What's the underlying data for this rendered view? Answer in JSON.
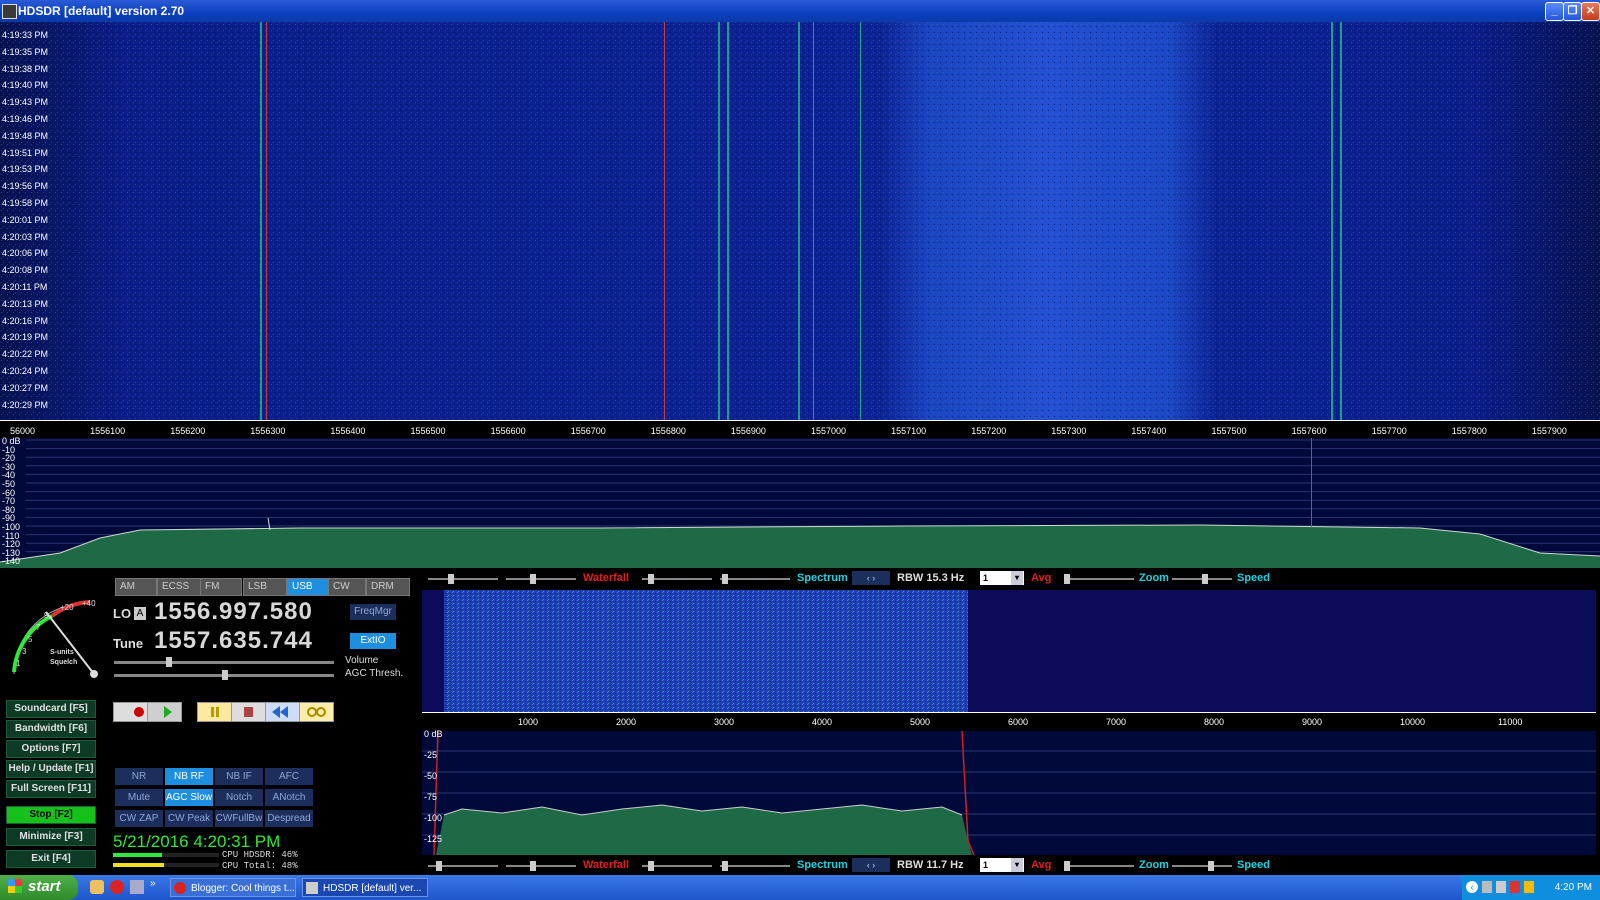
{
  "window": {
    "title": "HDSDR [default]  version 2.70"
  },
  "waterfall": {
    "times": [
      "4:19:33 PM",
      "4:19:35 PM",
      "4:19:38 PM",
      "4:19:40 PM",
      "4:19:43 PM",
      "4:19:46 PM",
      "4:19:48 PM",
      "4:19:51 PM",
      "4:19:53 PM",
      "4:19:56 PM",
      "4:19:58 PM",
      "4:20:01 PM",
      "4:20:03 PM",
      "4:20:06 PM",
      "4:20:08 PM",
      "4:20:11 PM",
      "4:20:13 PM",
      "4:20:16 PM",
      "4:20:19 PM",
      "4:20:22 PM",
      "4:20:24 PM",
      "4:20:27 PM",
      "4:20:29 PM"
    ]
  },
  "freq_axis": [
    "56000",
    "1556100",
    "1556200",
    "1556300",
    "1556400",
    "1556500",
    "1556600",
    "1556700",
    "1556800",
    "1556900",
    "1557000",
    "1557100",
    "1557200",
    "1557300",
    "1557400",
    "1557500",
    "1557600",
    "1557700",
    "1557800",
    "1557900"
  ],
  "spectrum": {
    "db_labels": [
      "0 dB",
      "-10",
      "-20",
      "-30",
      "-40",
      "-50",
      "-60",
      "-70",
      "-80",
      "-90",
      "-100",
      "-110",
      "-120",
      "-130",
      "-140"
    ]
  },
  "modes": [
    {
      "label": "AM",
      "on": false
    },
    {
      "label": "ECSS",
      "on": false
    },
    {
      "label": "FM",
      "on": false
    },
    {
      "label": "LSB",
      "on": false
    },
    {
      "label": "USB",
      "on": true
    },
    {
      "label": "CW",
      "on": false
    },
    {
      "label": "DRM",
      "on": false
    }
  ],
  "smeter": {
    "labels": [
      "+40",
      "+20",
      "9",
      "7",
      "5",
      "3",
      "1",
      "S-units",
      "Squelch"
    ]
  },
  "lo": {
    "label": "LO",
    "badge": "A",
    "value": "1556.997.580"
  },
  "tune": {
    "label": "Tune",
    "value": "1557.635.744"
  },
  "buttons": {
    "freqmgr": "FreqMgr",
    "extio": "ExtIO",
    "volume": "Volume",
    "agc_thresh": "AGC Thresh."
  },
  "left_buttons": [
    {
      "label": "Soundcard  [F5]"
    },
    {
      "label": "Bandwidth  [F6]"
    },
    {
      "label": "Options     [F7]"
    },
    {
      "label": "Help / Update  [F1]"
    },
    {
      "label": "Full Screen  [F11]"
    },
    {
      "label": "Stop         [F2]"
    },
    {
      "label": "Minimize   [F3]"
    },
    {
      "label": "Exit         [F4]"
    }
  ],
  "dsp_buttons": [
    {
      "label": "NR",
      "on": false
    },
    {
      "label": "NB RF",
      "on": true
    },
    {
      "label": "NB IF",
      "on": false
    },
    {
      "label": "AFC",
      "on": false
    },
    {
      "label": "Mute",
      "on": false
    },
    {
      "label": "AGC Slow",
      "on": true
    },
    {
      "label": "Notch",
      "on": false
    },
    {
      "label": "ANotch",
      "on": false
    },
    {
      "label": "CW ZAP",
      "on": false
    },
    {
      "label": "CW Peak",
      "on": false
    },
    {
      "label": "CWFullBw",
      "on": false
    },
    {
      "label": "Despread",
      "on": false
    }
  ],
  "datetime": "5/21/2016 4:20:31 PM",
  "cpu": {
    "hdsdr_label": "CPU HDSDR: 46%",
    "total_label": "CPU Total: 48%",
    "hdsdr": 0.46,
    "total": 0.48
  },
  "upper_bar": {
    "waterfall": "Waterfall",
    "spectrum": "Spectrum",
    "rbw": "RBW 15.3 Hz",
    "avg_value": "1",
    "avg": "Avg",
    "zoom": "Zoom",
    "speed": "Speed"
  },
  "lower_bar": {
    "waterfall": "Waterfall",
    "spectrum": "Spectrum",
    "rbw": "RBW 11.7 Hz",
    "avg_value": "1",
    "avg": "Avg",
    "zoom": "Zoom",
    "speed": "Speed"
  },
  "zoom_axis": [
    "1000",
    "2000",
    "3000",
    "4000",
    "5000",
    "6000",
    "7000",
    "8000",
    "9000",
    "10000",
    "11000"
  ],
  "zoom_db": [
    "0 dB",
    "-25",
    "-50",
    "-75",
    "-100",
    "-125"
  ],
  "taskbar": {
    "start": "start",
    "tasks": [
      "Blogger: Cool things t...",
      "HDSDR [default] ver..."
    ],
    "clock": "4:20 PM"
  },
  "colors": {
    "title_bar": "#0a3fbf",
    "waterfall_bg": "#0c1a7a",
    "usb_on": "#1e8fe0",
    "stop_green": "#16c21a",
    "datetime_green": "#2ee83a"
  }
}
